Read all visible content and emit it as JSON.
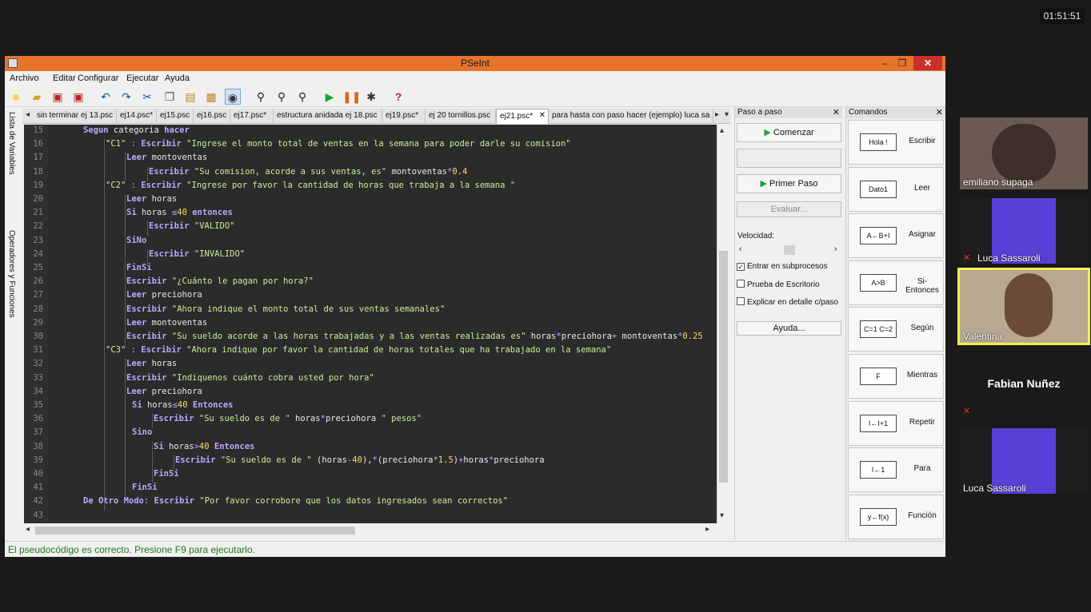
{
  "clock": "01:51:51",
  "window": {
    "title": "PSeInt",
    "min": "–",
    "max": "❐",
    "close": "✕"
  },
  "menu": [
    "Archivo",
    "Editar",
    "Configurar",
    "Ejecutar",
    "Ayuda"
  ],
  "toolbar_icons": [
    "new-file-icon",
    "open-folder-icon",
    "save-icon",
    "save-as-icon",
    "undo-icon",
    "redo-icon",
    "cut-icon",
    "copy-icon",
    "paste-icon",
    "select-icon",
    "indent-icon",
    "find-icon",
    "find-next-icon",
    "replace-icon",
    "run-icon",
    "step-icon",
    "debug-icon",
    "help-icon"
  ],
  "left_strip": {
    "variables": "Lista de Variables",
    "operators": "Operadores y Funciones"
  },
  "tabs": [
    "sin terminar ej 13.psc",
    "ej14.psc*",
    "ej15.psc",
    "ej16.psc",
    "ej17.psc*",
    "estructura anidada ej 18.psc",
    "ej19.psc*",
    "ej 20 tornillos.psc",
    "ej21.psc*",
    "para hasta con paso hacer (ejemplo) luca sa"
  ],
  "active_tab_close": "✕",
  "line_numbers": [
    "15",
    "16",
    "17",
    "18",
    "19",
    "20",
    "21",
    "22",
    "23",
    "24",
    "25",
    "26",
    "27",
    "28",
    "29",
    "30",
    "31",
    "32",
    "33",
    "34",
    "35",
    "36",
    "37",
    "38",
    "39",
    "40",
    "41",
    "42",
    "43"
  ],
  "status": "El pseudocódigo es correcto. Presione F9 para ejecutarlo.",
  "step_panel": {
    "title": "Paso a paso",
    "comenzar": "Comenzar",
    "primer_paso": "Primer Paso",
    "evaluar": "Evaluar...",
    "velocidad": "Velocidad:",
    "chk_subprocesos": "Entrar en subprocesos",
    "chk_escritorio": "Prueba de Escritorio",
    "chk_explicar": "Explicar en detalle c/paso",
    "ayuda": "Ayuda..."
  },
  "commands_panel": {
    "title": "Comandos",
    "items": [
      {
        "icon": "Hola !",
        "label": "Escribir"
      },
      {
        "icon": "Dato1",
        "label": "Leer"
      },
      {
        "icon": "A←B+I",
        "label": "Asignar"
      },
      {
        "icon": "A>B",
        "label": "Si-Entonces"
      },
      {
        "icon": "C=1 C=2",
        "label": "Según"
      },
      {
        "icon": "F",
        "label": "Mientras"
      },
      {
        "icon": "I←I+1",
        "label": "Repetir"
      },
      {
        "icon": "I←1",
        "label": "Para"
      },
      {
        "icon": "y←f(x)",
        "label": "Función"
      }
    ]
  },
  "participants": [
    {
      "name": "emiliano supaga"
    },
    {
      "name": "Luca Sassaroli"
    },
    {
      "name": "Valentina"
    },
    {
      "name": "Fabian Nuñez"
    },
    {
      "name": "Luca Sassaroli"
    }
  ],
  "colors": {
    "titlebar": "#e8732b",
    "editor_bg": "#2b2b2b",
    "keyword": "#bba8ff",
    "string": "#c8ee9a",
    "number": "#f2dd6a",
    "status_text": "#1d7a1d",
    "speaker_border": "#f0f050"
  }
}
